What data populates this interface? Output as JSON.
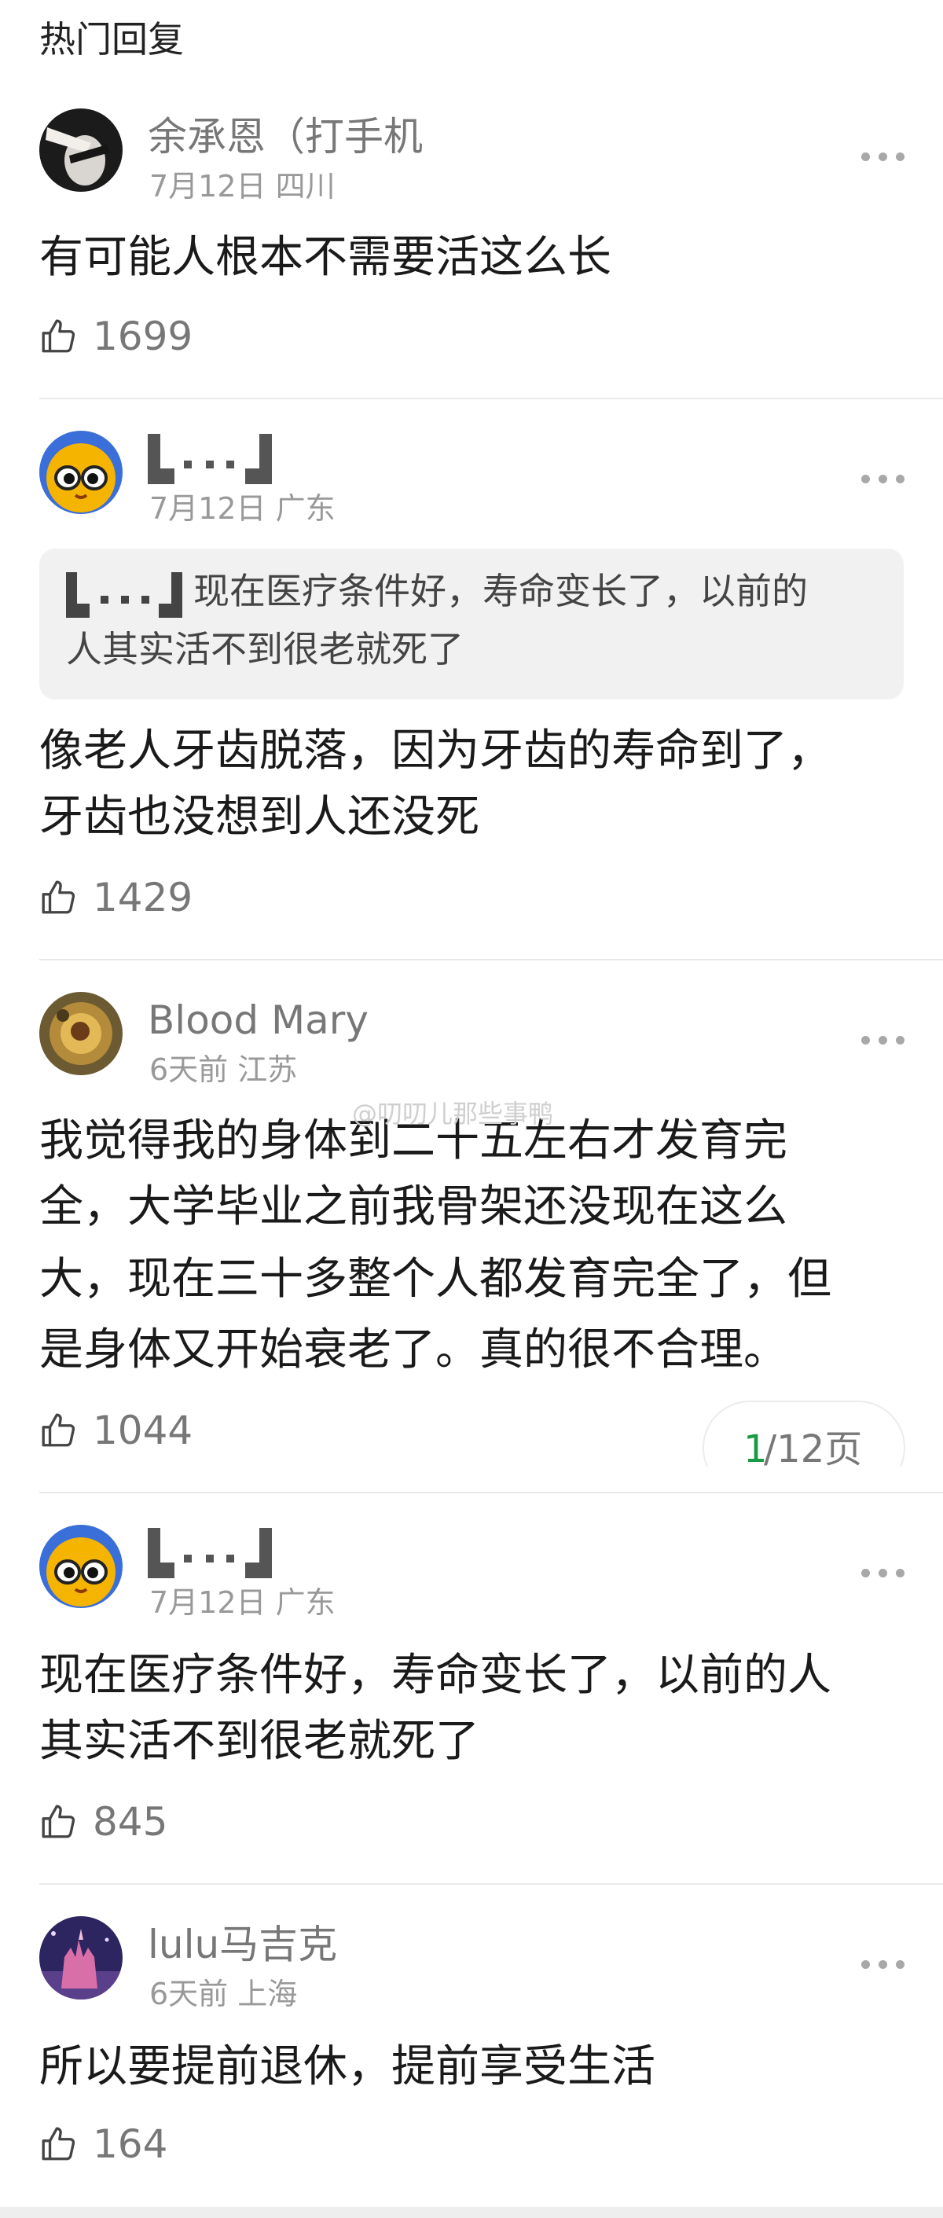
{
  "section_title": "热门回复",
  "colors": {
    "accent": "#1a9a47",
    "like_icon": "#444444",
    "username": "#777777",
    "meta": "#999999"
  },
  "comments": [
    {
      "username": "余承恩（打手机",
      "date": "7月12日",
      "location": "四川",
      "text": "有可能人根本不需要活这么长",
      "likes": "1699"
    },
    {
      "username": "",
      "date": "7月12日",
      "location": "广东",
      "quote": {
        "line1": "现在医疗条件好，寿命变长了，以前的",
        "line2": "人其实活不到很老就死了"
      },
      "text_line1": "像老人牙齿脱落，因为牙齿的寿命到了，",
      "text_line2": "牙齿也没想到人还没死",
      "likes": "1429"
    },
    {
      "username": "Blood Mary",
      "date": "6天前",
      "location": "江苏",
      "text_line1": "我觉得我的身体到二十五左右才发育完",
      "text_line2": "全，大学毕业之前我骨架还没现在这么",
      "text_line3": "大，现在三十多整个人都发育完全了，但",
      "text_line4": "是身体又开始衰老了。真的很不合理。",
      "likes": "1044"
    },
    {
      "username": "",
      "date": "7月12日",
      "location": "广东",
      "text_line1": "现在医疗条件好，寿命变长了，以前的人",
      "text_line2": "其实活不到很老就死了",
      "likes": "845"
    },
    {
      "username": "lulu马吉克",
      "date": "6天前",
      "location": "上海",
      "text": "所以要提前退休，提前享受生活",
      "likes": "164"
    }
  ],
  "watermark": "@叨叨儿那些事鸭",
  "pager": {
    "current": "1",
    "rest": "/12页"
  },
  "icons": {
    "like": "thumbs-up-icon",
    "more": "more-dots-icon"
  }
}
